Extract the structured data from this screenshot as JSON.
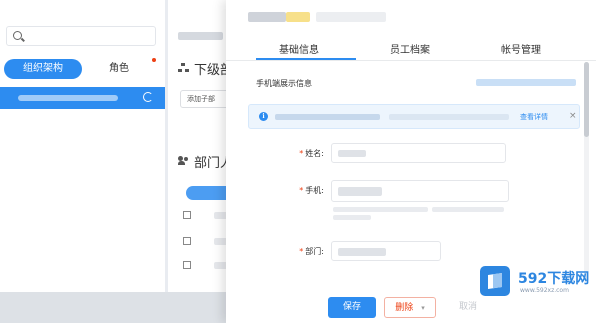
{
  "left_panel": {
    "tabs": [
      {
        "label": "组织架构",
        "active": true
      },
      {
        "label": "角色",
        "active": false
      }
    ]
  },
  "mid_panel": {
    "section1_title": "下级部",
    "add_button_label": "添加子部",
    "section2_title": "部门人"
  },
  "drawer": {
    "tabs": [
      {
        "label": "基础信息",
        "active": true
      },
      {
        "label": "员工档案",
        "active": false
      },
      {
        "label": "帐号管理",
        "active": false
      }
    ],
    "section_title": "手机端展示信息",
    "notice": {
      "icon": "info-icon",
      "link_label": "查看详情",
      "close": "×"
    },
    "fields": [
      {
        "label": "姓名:",
        "required": true
      },
      {
        "label": "手机:",
        "required": true
      },
      {
        "label": "部门:",
        "required": true
      }
    ],
    "footer": {
      "save_label": "保存",
      "delete_label": "删除",
      "cancel_label": "取消"
    }
  },
  "watermark": {
    "title": "592下载网",
    "url": "www.592xz.com"
  },
  "colors": {
    "accent": "#2d8cf0",
    "danger": "#ed4014"
  }
}
